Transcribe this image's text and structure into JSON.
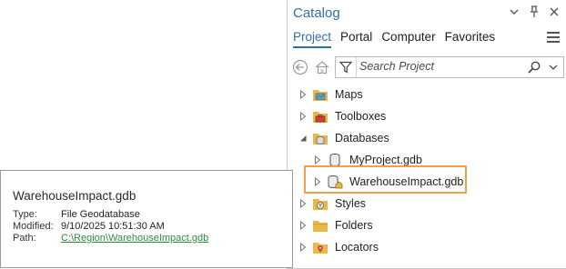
{
  "pane": {
    "title": "Catalog",
    "tabs": [
      {
        "label": "Project",
        "active": true
      },
      {
        "label": "Portal",
        "active": false
      },
      {
        "label": "Computer",
        "active": false
      },
      {
        "label": "Favorites",
        "active": false
      }
    ]
  },
  "search": {
    "placeholder": "Search Project"
  },
  "tree": {
    "maps": "Maps",
    "toolboxes": "Toolboxes",
    "databases": "Databases",
    "myproject": "MyProject.gdb",
    "warehouse": "WarehouseImpact.gdb",
    "styles": "Styles",
    "folders": "Folders",
    "locators": "Locators"
  },
  "tooltip": {
    "title": "WarehouseImpact.gdb",
    "type_label": "Type:",
    "type_value": "File Geodatabase",
    "modified_label": "Modified:",
    "modified_value": "9/10/2025 10:51:30 AM",
    "path_label": "Path:",
    "path_value": "C:\\Region\\WarehouseImpact.gdb"
  },
  "colors": {
    "accent": "#2f6fa8",
    "highlight": "#f0a04b",
    "folder": "#e8b84a",
    "link": "#2e8b3c"
  }
}
